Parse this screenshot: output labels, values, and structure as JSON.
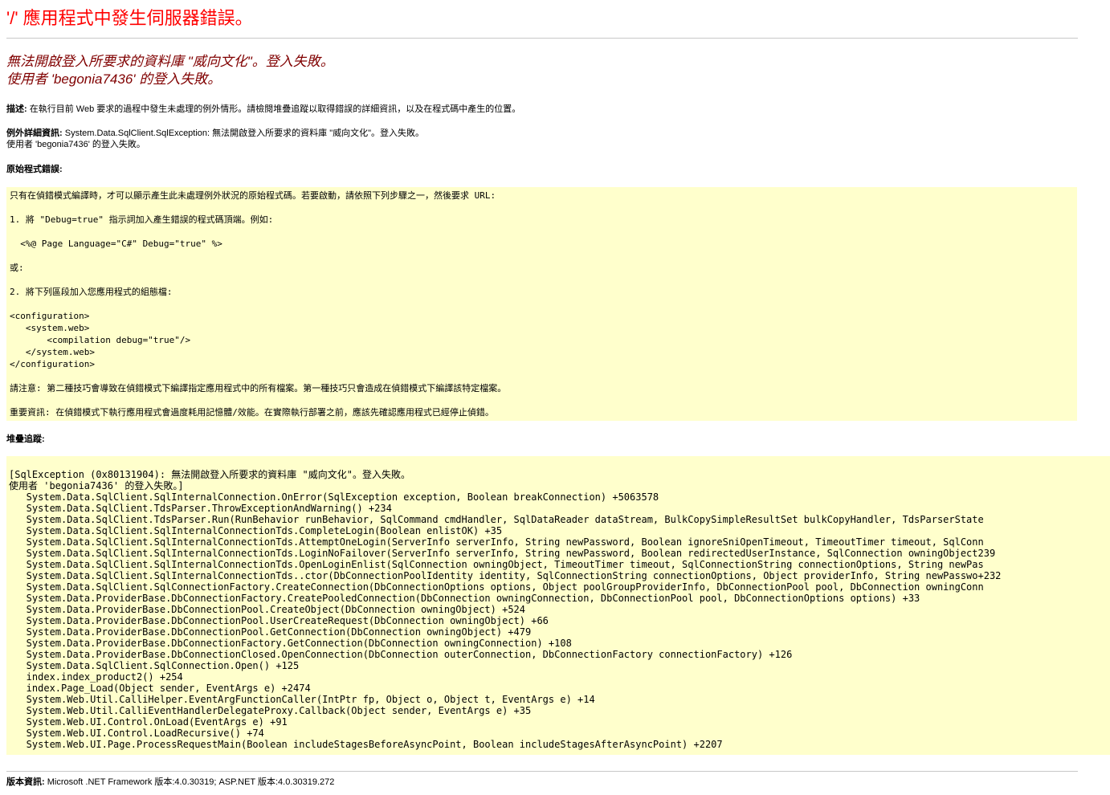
{
  "title": "'/' 應用程式中發生伺服器錯誤。",
  "subtitle": {
    "line1": "無法開啟登入所要求的資料庫 \"威向文化\"。登入失敗。",
    "line2": "使用者 'begonia7436' 的登入失敗。"
  },
  "description": {
    "label": "描述:",
    "text": " 在執行目前 Web 要求的過程中發生未處理的例外情形。請檢閱堆疊追蹤以取得錯誤的詳細資訊，以及在程式碼中產生的位置。"
  },
  "exception": {
    "label": "例外詳細資訊:",
    "type": " System.Data.SqlClient.SqlException:",
    "message1": " 無法開啟登入所要求的資料庫 \"威向文化\"。登入失敗。",
    "message2": "使用者 'begonia7436' 的登入失敗。"
  },
  "source_error": {
    "label": "原始程式錯誤:",
    "lines": [
      "只有在偵錯模式編譯時，才可以顯示產生此未處理例外狀況的原始程式碼。若要啟動，請依照下列步驟之一，然後要求 URL:",
      "1. 將 \"Debug=true\" 指示詞加入產生錯誤的程式碼頂端。例如:",
      "  <%@ Page Language=\"C#\" Debug=\"true\" %>",
      "或:",
      "2. 將下列區段加入您應用程式的組態檔:",
      "<configuration>",
      "   <system.web>",
      "       <compilation debug=\"true\"/>",
      "   </system.web>",
      "</configuration>",
      "請注意: 第二種技巧會導致在偵錯模式下編譯指定應用程式中的所有檔案。第一種技巧只會造成在偵錯模式下編譯該特定檔案。",
      "重要資訊: 在偵錯模式下執行應用程式會過度耗用記憶體/效能。在實際執行部署之前，應該先確認應用程式已經停止偵錯。"
    ]
  },
  "stack_trace": {
    "label": "堆疊追蹤:",
    "lines": [
      "[SqlException (0x80131904): 無法開啟登入所要求的資料庫 \"威向文化\"。登入失敗。",
      "使用者 'begonia7436' 的登入失敗。]",
      "   System.Data.SqlClient.SqlInternalConnection.OnError(SqlException exception, Boolean breakConnection) +5063578",
      "   System.Data.SqlClient.TdsParser.ThrowExceptionAndWarning() +234",
      "   System.Data.SqlClient.TdsParser.Run(RunBehavior runBehavior, SqlCommand cmdHandler, SqlDataReader dataStream, BulkCopySimpleResultSet bulkCopyHandler, TdsParserState",
      "   System.Data.SqlClient.SqlInternalConnectionTds.CompleteLogin(Boolean enlistOK) +35",
      "   System.Data.SqlClient.SqlInternalConnectionTds.AttemptOneLogin(ServerInfo serverInfo, String newPassword, Boolean ignoreSniOpenTimeout, TimeoutTimer timeout, SqlConn",
      "   System.Data.SqlClient.SqlInternalConnectionTds.LoginNoFailover(ServerInfo serverInfo, String newPassword, Boolean redirectedUserInstance, SqlConnection owningObject239",
      "   System.Data.SqlClient.SqlInternalConnectionTds.OpenLoginEnlist(SqlConnection owningObject, TimeoutTimer timeout, SqlConnectionString connectionOptions, String newPas",
      "   System.Data.SqlClient.SqlInternalConnectionTds..ctor(DbConnectionPoolIdentity identity, SqlConnectionString connectionOptions, Object providerInfo, String newPasswo+232",
      "   System.Data.SqlClient.SqlConnectionFactory.CreateConnection(DbConnectionOptions options, Object poolGroupProviderInfo, DbConnectionPool pool, DbConnection owningConn",
      "   System.Data.ProviderBase.DbConnectionFactory.CreatePooledConnection(DbConnection owningConnection, DbConnectionPool pool, DbConnectionOptions options) +33",
      "   System.Data.ProviderBase.DbConnectionPool.CreateObject(DbConnection owningObject) +524",
      "   System.Data.ProviderBase.DbConnectionPool.UserCreateRequest(DbConnection owningObject) +66",
      "   System.Data.ProviderBase.DbConnectionPool.GetConnection(DbConnection owningObject) +479",
      "   System.Data.ProviderBase.DbConnectionFactory.GetConnection(DbConnection owningConnection) +108",
      "   System.Data.ProviderBase.DbConnectionClosed.OpenConnection(DbConnection outerConnection, DbConnectionFactory connectionFactory) +126",
      "   System.Data.SqlClient.SqlConnection.Open() +125",
      "   index.index_product2() +254",
      "   index.Page_Load(Object sender, EventArgs e) +2474",
      "   System.Web.Util.CalliHelper.EventArgFunctionCaller(IntPtr fp, Object o, Object t, EventArgs e) +14",
      "   System.Web.Util.CalliEventHandlerDelegateProxy.Callback(Object sender, EventArgs e) +35",
      "   System.Web.UI.Control.OnLoad(EventArgs e) +91",
      "   System.Web.UI.Control.LoadRecursive() +74",
      "   System.Web.UI.Page.ProcessRequestMain(Boolean includeStagesBeforeAsyncPoint, Boolean includeStagesAfterAsyncPoint) +2207"
    ]
  },
  "version": {
    "label": "版本資訊:",
    "text": " Microsoft .NET Framework 版本:4.0.30319; ASP.NET 版本:4.0.30319.272"
  },
  "colors": {
    "title": "#ff0000",
    "subtitle": "#800000",
    "code_background": "#ffffcc"
  }
}
